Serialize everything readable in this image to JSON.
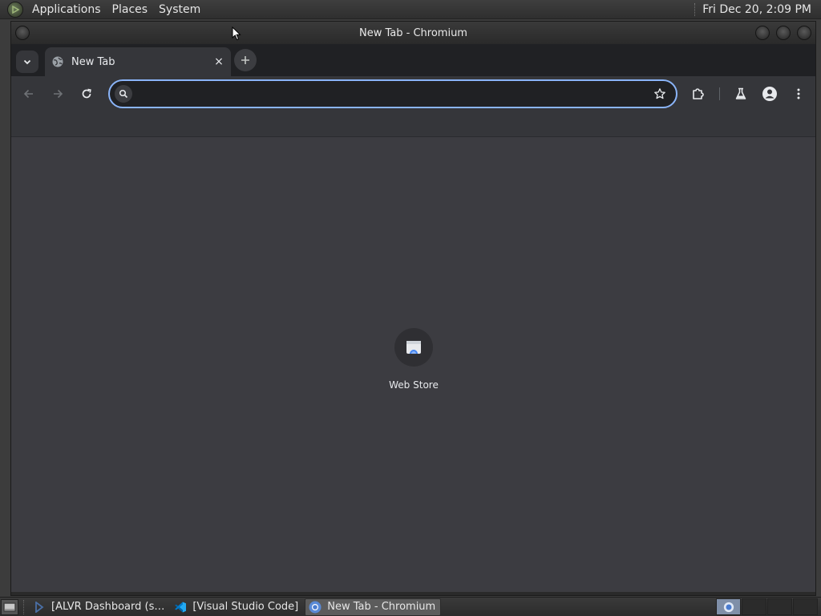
{
  "top_panel": {
    "menus": [
      "Applications",
      "Places",
      "System"
    ],
    "clock": "Fri Dec 20,  2:09 PM"
  },
  "window": {
    "title": "New Tab - Chromium"
  },
  "tabs": [
    {
      "title": "New Tab",
      "close": "×"
    }
  ],
  "omnibox": {
    "value": "",
    "placeholder": ""
  },
  "shortcuts": [
    {
      "label": "Web Store",
      "icon": "web-store-icon"
    }
  ],
  "taskbar": {
    "tasks": [
      {
        "label": "[ALVR Dashboard (s…",
        "icon": "alvr-icon"
      },
      {
        "label": "[Visual Studio Code]",
        "icon": "vscode-icon"
      },
      {
        "label": "New Tab - Chromium",
        "icon": "chromium-icon",
        "active": true
      }
    ]
  },
  "colors": {
    "accent": "#8ab4f8",
    "toolbar": "#35363a",
    "tabstrip": "#202124",
    "content_bg": "#3c3c41"
  }
}
